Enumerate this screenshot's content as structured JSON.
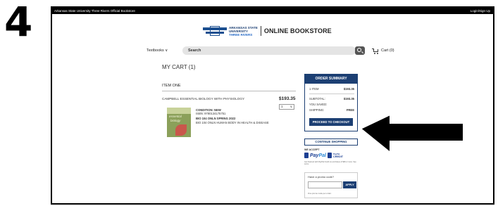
{
  "step_number": "4",
  "topbar": {
    "store_name": "Arkansas State University Three Rivers Official Bookstore",
    "login": "Login/Sign Up"
  },
  "logo": {
    "line1": "ARKANSAS STATE",
    "line2": "UNIVERSITY",
    "line3": "THREE RIVERS",
    "store": "ONLINE BOOKSTORE"
  },
  "nav": {
    "textbooks": "Textbooks",
    "chevron": "∨",
    "search_placeholder": "Search",
    "cart_label": "Cart (0)"
  },
  "cart": {
    "title": "MY CART (1)",
    "item_header": "ITEM ONE",
    "item": {
      "title": "CAMPBELL ESSENTIAL BIOLOGY WITH PHYSIOLOGY",
      "price": "$193.35",
      "quantity": "1",
      "qty_chevron": "∨",
      "condition": "CONDITION: NEW",
      "isbn": "ISBN: 9780134175751",
      "course_line": "BIO 104 ONLN  SPRING 2022",
      "course_name": "BIO 104 ONLN HUMAN BODY IN HEALTH & DISEASE",
      "cover_word1": "essential",
      "cover_word2": "biology"
    }
  },
  "summary": {
    "header": "ORDER SUMMARY",
    "items_label": "1 ITEM",
    "items_value": "$193.35",
    "subtotal_label": "SUBTOTAL:",
    "subtotal_value": "$193.35",
    "saved_label": "YOU SAVED:",
    "saved_value": "",
    "shipping_label": "SHIPPING:",
    "shipping_value": "FREE",
    "checkout_button": "PROCEED TO CHECKOUT"
  },
  "continue_button": "CONTINUE SHOPPING",
  "payment": {
    "we_accept": "WE ACCEPT",
    "paypal_pay": "Pay",
    "paypal_pal": "Pal",
    "paypal_credit_top": "PayPal",
    "paypal_credit_bottom": "CREDIT",
    "fine_print": "Get financed with PayPal Credit on purchases of $99 or more. See terms."
  },
  "promo": {
    "label": "Have a promo code?",
    "apply_button": "APPLY",
    "note": "One promo code per order."
  },
  "colors": {
    "brand_navy": "#1c3f73",
    "paypal_blue": "#1c3f93",
    "paypal_light": "#2a8ad6"
  }
}
